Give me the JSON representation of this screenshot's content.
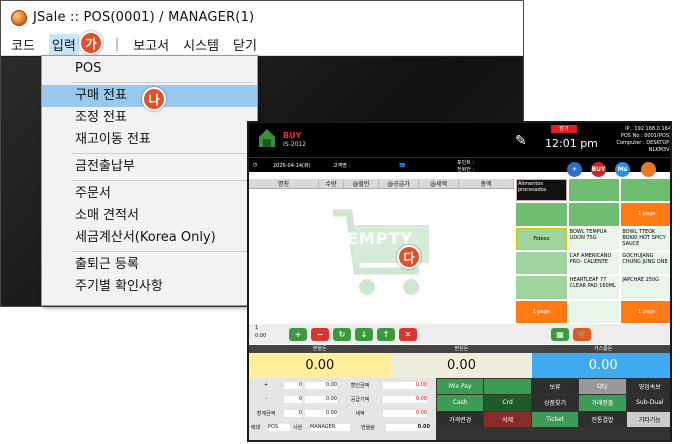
{
  "window_a": {
    "title": "JSale  ::  POS(0001) / MANAGER(1)",
    "menu": [
      "코드",
      "입력",
      "|",
      "보고서",
      "시스템",
      "닫기"
    ],
    "badge": "가",
    "dropdown": {
      "items": [
        "POS",
        "구매 전표",
        "조정 전표",
        "재고이동 전표",
        "금전출납부",
        "주문서",
        "소매 견적서",
        "세금계산서(Korea Only)",
        "출퇴근 등록",
        "주기별 확인사항"
      ],
      "highlighted": "구매 전표",
      "badge": "나"
    }
  },
  "window_b": {
    "logo": {
      "buy": "BUY",
      "sub": "IS-2012"
    },
    "clock": "12:01 pm",
    "logout_label": "닫기",
    "info": [
      "IP : 192.168.0.164",
      "POS No : 0001(POS)",
      "Computer : DESKTOP-NLKM3VI"
    ],
    "bar2": {
      "date": "2026-04-14(화)",
      "customer": "고객명 :",
      "points": "포인트 :",
      "phone": "전화번 :"
    },
    "round_buttons": [
      "+",
      "BUY",
      "Ms",
      ""
    ],
    "columns": [
      "명칭",
      "수량",
      "@할인",
      "@공급가",
      "@세액",
      "총액"
    ],
    "empty_label": "EMPTY",
    "badge": "다",
    "grid": {
      "category": "Alimentos procesados",
      "page_label": "1 page",
      "fideos": "Fideos",
      "products": [
        "BOWL TEMPUA UDON 75G",
        "BOWL TTEOK BOKKI HOT SPICY SAUCE",
        "CAF AMERICANO PRO- CALIENTE",
        "GOCHUJANG CHUNG JUNG ONE",
        "HEARTLEAF 77 CLEAR PAD 160ML",
        "JAPCHAE 250G"
      ]
    },
    "tool_qty": "1",
    "tool_amount": "0.00",
    "totals": [
      {
        "label": "받을돈",
        "value": "0.00"
      },
      {
        "label": "받은돈",
        "value": "0.00"
      },
      {
        "label": "거스름돈",
        "value": "0.00"
      }
    ],
    "inputs": {
      "rows": [
        {
          "label": "+",
          "qty": "0",
          "amount": "0.00",
          "side": "할인금액",
          "side_val": "0.00"
        },
        {
          "label": "-",
          "qty": "0",
          "amount": "0.00",
          "side": "공급가액",
          "side_val": "0.00"
        },
        {
          "label": "할계금액",
          "qty": "0",
          "amount": "0.00",
          "side": "세액",
          "side_val": "0.00"
        }
      ],
      "footer": [
        "매대",
        "POS",
        "사원",
        "MANAGER",
        "반올림",
        "0.00"
      ]
    },
    "pad": [
      "Mix Pay",
      "",
      "보류",
      "Qty",
      "영업속보",
      "Cash",
      "Crd",
      "상품찾기",
      "가래장출",
      "Sub-Dual",
      "가격변경",
      "삭제",
      "Ticket",
      "전통결합",
      "기타기능"
    ]
  },
  "colors": {
    "green": "#6fbe6f",
    "orange": "#ff7a15",
    "badge": "#e2502a",
    "highlight": "#99c9ef"
  }
}
